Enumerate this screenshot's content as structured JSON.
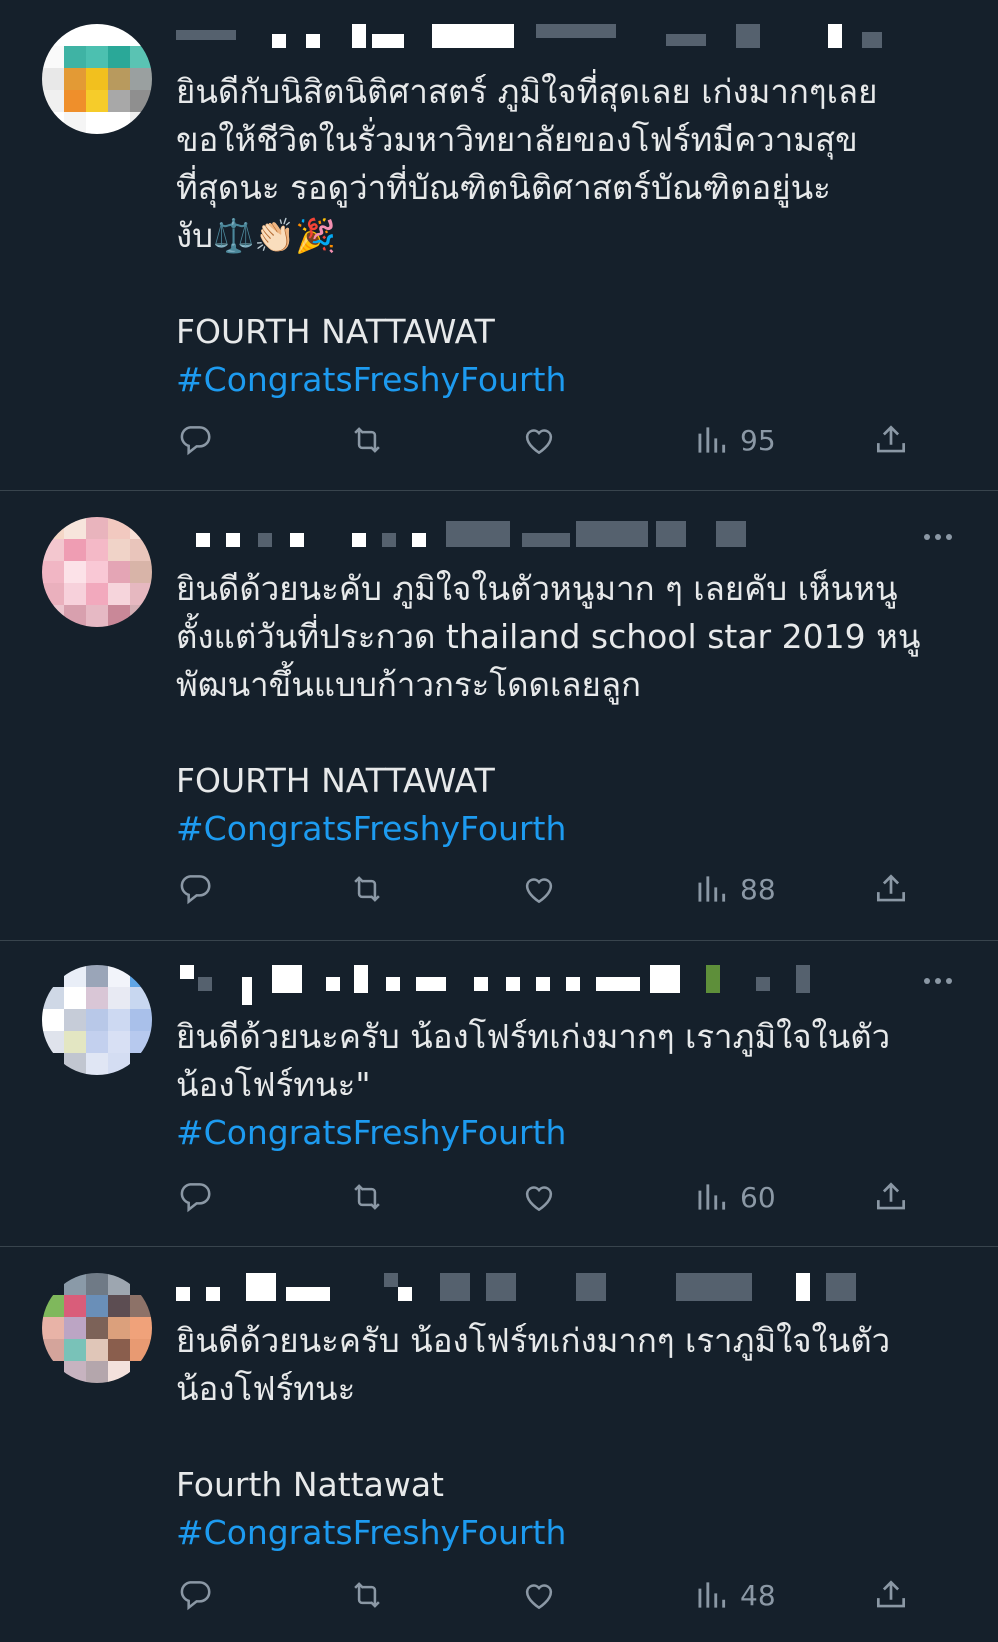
{
  "tweets": [
    {
      "text_lines": [
        "ยินดีกับนิสิตนิติศาสตร์ ภูมิใจที่สุดเลย เก่งมากๆเลย",
        "ขอให้ชีวิตในรั่วมหาวิทยาลัยของโฟร์ทมีความสุข",
        "ที่สุดนะ รอดูว่าที่บัณฑิตนิติศาสตร์บัณฑิตอยู่นะ",
        "งับ⚖️👏🏻🎉"
      ],
      "extra_line": "FOURTH NATTAWAT",
      "hashtag": "#CongratsFreshyFourth",
      "views": "95",
      "icons": [
        "reply-icon",
        "retweet-icon",
        "like-icon",
        "views-icon",
        "share-icon"
      ]
    },
    {
      "text_lines": [
        "ยินดีด้วยนะคับ ภูมิใจในตัวหนูมาก ๆ เลยคับ เห็นหนู",
        "ตั้งแต่วันที่ประกวด thailand school star 2019 หนู",
        "พัฒนาขึ้นแบบก้าวกระโดดเลยลูก"
      ],
      "extra_line": "FOURTH NATTAWAT",
      "hashtag": "#CongratsFreshyFourth",
      "views": "88"
    },
    {
      "text_lines": [
        "ยินดีด้วยนะครับ น้องโฟร์ทเก่งมากๆ เราภูมิใจในตัว",
        "น้องโฟร์ทนะ\""
      ],
      "extra_line": "",
      "hashtag": "#CongratsFreshyFourth",
      "views": "60"
    },
    {
      "text_lines": [
        "ยินดีด้วยนะครับ น้องโฟร์ทเก่งมากๆ เราภูมิใจในตัว",
        "น้องโฟร์ทนะ"
      ],
      "extra_line": "Fourth Nattawat",
      "hashtag": "#CongratsFreshyFourth",
      "views": "48"
    }
  ],
  "colors": {
    "background": "#15202b",
    "text": "#e7e9ea",
    "hashtag": "#1d9bf0",
    "muted": "#8b98a5",
    "divider": "#38444d"
  }
}
